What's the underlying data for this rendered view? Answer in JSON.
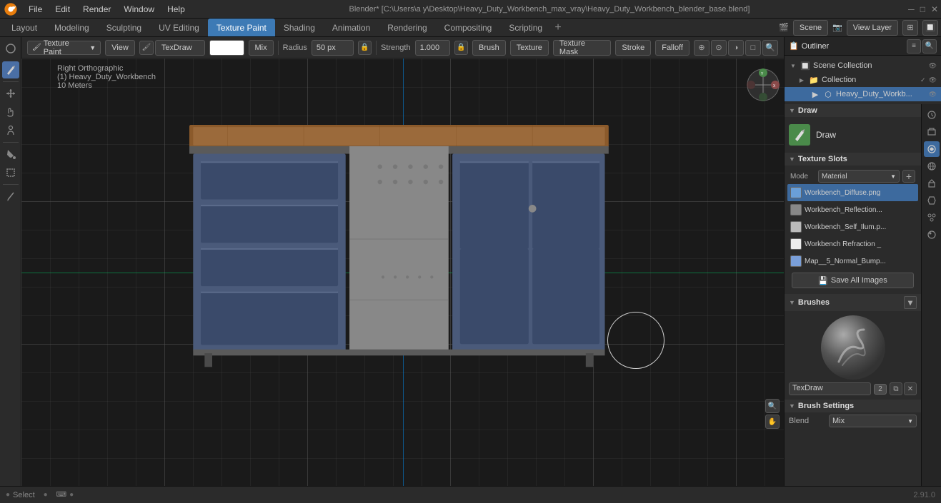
{
  "titlebar": {
    "title": "Blender* [C:\\Users\\a y\\Desktop\\Heavy_Duty_Workbench_max_vray\\Heavy_Duty_Workbench_blender_base.blend]",
    "app_name": "Blender*"
  },
  "menu": {
    "items": [
      "File",
      "Edit",
      "Render",
      "Window",
      "Help"
    ]
  },
  "workspaces": {
    "tabs": [
      {
        "label": "Layout",
        "active": false
      },
      {
        "label": "Modeling",
        "active": false
      },
      {
        "label": "Sculpting",
        "active": false
      },
      {
        "label": "UV Editing",
        "active": false
      },
      {
        "label": "Texture Paint",
        "active": true
      },
      {
        "label": "Shading",
        "active": false
      },
      {
        "label": "Animation",
        "active": false
      },
      {
        "label": "Rendering",
        "active": false
      },
      {
        "label": "Compositing",
        "active": false
      },
      {
        "label": "Scripting",
        "active": false
      }
    ],
    "add_label": "+"
  },
  "scene_selector": {
    "scene_icon": "🎬",
    "scene_name": "Scene",
    "view_layer_icon": "📷",
    "view_layer_name": "View Layer"
  },
  "header": {
    "mode_label": "Texture Paint",
    "view_label": "View",
    "brush_name": "TexDraw",
    "blend_mode": "Mix",
    "radius_label": "Radius",
    "radius_value": "50 px",
    "strength_label": "Strength",
    "strength_value": "1.000",
    "brush_dropdown": "Brush",
    "texture_dropdown": "Texture",
    "texture_mask_dropdown": "Texture Mask",
    "stroke_dropdown": "Stroke",
    "falloff_dropdown": "Falloff"
  },
  "viewport": {
    "view_mode": "Right Orthographic",
    "object_name": "(1) Heavy_Duty_Workbench",
    "scale_label": "10 Meters"
  },
  "outliner": {
    "scene_collection": "Scene Collection",
    "collection": "Collection",
    "object_name": "Heavy_Duty_Workb..."
  },
  "texture_slots": {
    "mode_label": "Mode",
    "mode_value": "Material",
    "slots_header": "Texture Slots",
    "add_btn": "+",
    "slots": [
      {
        "name": "Workbench_Diffuse.png",
        "color": "#6a9fd8",
        "active": true
      },
      {
        "name": "Workbench_Reflection...",
        "color": "#888",
        "active": false
      },
      {
        "name": "Workbench_Self_Ilum.p...",
        "color": "#aaa",
        "active": false
      },
      {
        "name": "Workbench Refraction _",
        "color": "#eee",
        "active": false
      },
      {
        "name": "Map__5_Normal_Bump...",
        "color": "#7a9fd8",
        "active": false
      }
    ],
    "save_all_images": "Save All Images"
  },
  "brushes": {
    "header": "Brushes",
    "brush_name": "TexDraw",
    "user_count": "2",
    "draw_label": "Draw",
    "draw_icon": "✏️"
  },
  "brush_settings": {
    "header": "Brush Settings",
    "blend_label": "Blend",
    "blend_value": "Mix"
  },
  "status_bar": {
    "select_label": "Select",
    "version": "2.91.0"
  },
  "left_toolbar": {
    "tools": [
      {
        "icon": "🖌",
        "name": "draw-tool",
        "active": true
      },
      {
        "icon": "↩",
        "name": "move-tool",
        "active": false
      },
      {
        "icon": "✋",
        "name": "grab-tool",
        "active": false
      },
      {
        "icon": "👤",
        "name": "person-tool",
        "active": false
      },
      {
        "icon": "💧",
        "name": "fill-tool",
        "active": false
      },
      {
        "icon": "⬜",
        "name": "mask-tool",
        "active": false
      },
      {
        "icon": "🖊",
        "name": "pen-tool",
        "active": false
      }
    ]
  },
  "side_tabs": {
    "icons": [
      "🔧",
      "📷",
      "🎬",
      "🔲",
      "🔧",
      "🌐",
      "🔴",
      "🔲"
    ]
  }
}
